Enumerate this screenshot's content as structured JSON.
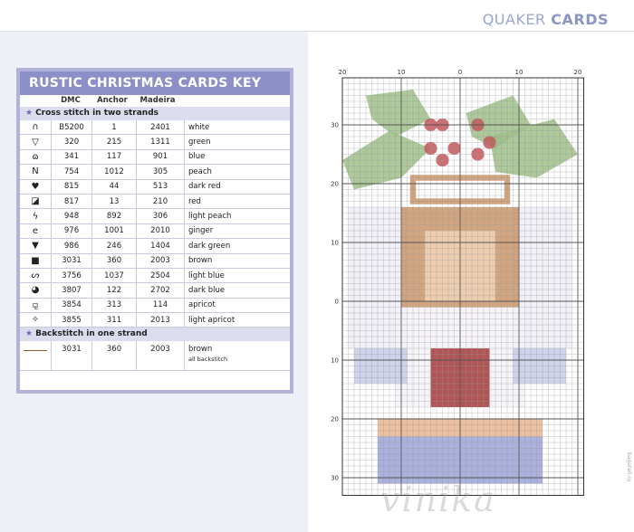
{
  "header": {
    "light": "QUAKER ",
    "bold": "CARDS"
  },
  "key": {
    "title": "RUSTIC CHRISTMAS CARDS KEY",
    "columns": [
      "DMC",
      "Anchor",
      "Madeira"
    ],
    "cross_section": "Cross stitch in two strands",
    "rows": [
      {
        "symbol": "∩",
        "dmc": "B5200",
        "anchor": "1",
        "madeira": "2401",
        "name": "white"
      },
      {
        "symbol": "▽",
        "dmc": "320",
        "anchor": "215",
        "madeira": "1311",
        "name": "green"
      },
      {
        "symbol": "ɷ",
        "dmc": "341",
        "anchor": "117",
        "madeira": "901",
        "name": "blue"
      },
      {
        "symbol": "N",
        "dmc": "754",
        "anchor": "1012",
        "madeira": "305",
        "name": "peach"
      },
      {
        "symbol": "♥",
        "dmc": "815",
        "anchor": "44",
        "madeira": "513",
        "name": "dark red"
      },
      {
        "symbol": "◪",
        "dmc": "817",
        "anchor": "13",
        "madeira": "210",
        "name": "red"
      },
      {
        "symbol": "ϟ",
        "dmc": "948",
        "anchor": "892",
        "madeira": "306",
        "name": "light peach"
      },
      {
        "symbol": "e",
        "dmc": "976",
        "anchor": "1001",
        "madeira": "2010",
        "name": "ginger"
      },
      {
        "symbol": "▼",
        "dmc": "986",
        "anchor": "246",
        "madeira": "1404",
        "name": "dark green"
      },
      {
        "symbol": "■",
        "dmc": "3031",
        "anchor": "360",
        "madeira": "2003",
        "name": "brown"
      },
      {
        "symbol": "ᔕ",
        "dmc": "3756",
        "anchor": "1037",
        "madeira": "2504",
        "name": "light blue"
      },
      {
        "symbol": "◕",
        "dmc": "3807",
        "anchor": "122",
        "madeira": "2702",
        "name": "dark blue"
      },
      {
        "symbol": "⚼",
        "dmc": "3854",
        "anchor": "313",
        "madeira": "114",
        "name": "apricot"
      },
      {
        "symbol": "✧",
        "dmc": "3855",
        "anchor": "311",
        "madeira": "2013",
        "name": "light apricot"
      }
    ],
    "back_section": "Backstitch in one strand",
    "backstitch": {
      "dmc": "3031",
      "anchor": "360",
      "madeira": "2003",
      "name": "brown",
      "note": "all backstitch"
    }
  },
  "chart": {
    "top_ticks": [
      "20",
      "10",
      "0",
      "10",
      "20"
    ],
    "left_ticks": [
      "30",
      "20",
      "10",
      "0",
      "10",
      "20",
      "30"
    ],
    "colors": {
      "dark_green": "#6b8f5a",
      "green": "#9fc08a",
      "red": "#c2565a",
      "dark_red": "#a33a3a",
      "peach": "#f2d3b8",
      "ginger": "#c9956a",
      "brown": "#8a5a34",
      "light_blue": "#c7cbe8",
      "blue": "#9ba3d6",
      "apricot": "#e8b48e",
      "white": "#ffffff"
    }
  },
  "watermark": "vinika",
  "credit": "bagatell.ru"
}
